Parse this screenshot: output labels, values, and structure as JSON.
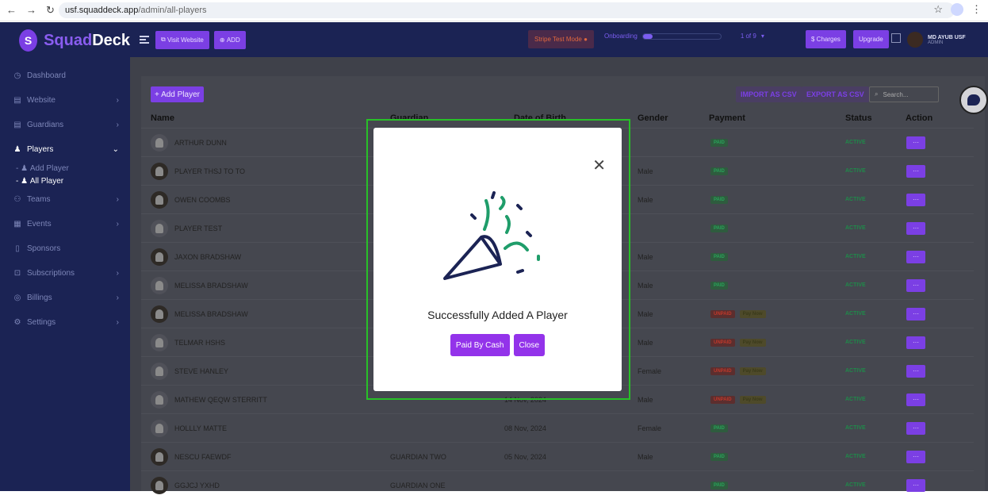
{
  "browser": {
    "host": "usf.squaddeck.app",
    "path": "/admin/all-players"
  },
  "logo": {
    "part1": "Squad",
    "part2": "Deck"
  },
  "sidebar": {
    "items": [
      {
        "label": "Dashboard",
        "icon": "dashboard-icon"
      },
      {
        "label": "Website",
        "icon": "website-icon"
      },
      {
        "label": "Guardians",
        "icon": "guardians-icon"
      },
      {
        "label": "Players",
        "icon": "players-icon"
      },
      {
        "label": "Teams",
        "icon": "teams-icon"
      },
      {
        "label": "Events",
        "icon": "events-icon"
      },
      {
        "label": "Sponsors",
        "icon": "sponsors-icon"
      },
      {
        "label": "Subscriptions",
        "icon": "subscriptions-icon"
      },
      {
        "label": "Billings",
        "icon": "billings-icon"
      },
      {
        "label": "Settings",
        "icon": "settings-icon"
      }
    ],
    "sub": {
      "add": "Add Player",
      "all": "All Player"
    }
  },
  "topbar": {
    "visit": "Visit Website",
    "add": "ADD",
    "stripe": "Stripe Test Mode",
    "onboarding": "Onboarding",
    "onboarding_progress": 0.12,
    "onboarding_count": "1 of 9",
    "charges": "Charges",
    "upgrade": "Upgrade",
    "user_name": "MD AYUB USF",
    "user_role": "ADMIN"
  },
  "toolbar": {
    "add_player": "+ Add Player",
    "import": "IMPORT AS CSV",
    "export": "EXPORT AS CSV",
    "search_placeholder": "Search..."
  },
  "table": {
    "headers": {
      "name": "Name",
      "guardian": "Guardian",
      "dob": "Date of Birth",
      "gender": "Gender",
      "payment": "Payment",
      "status": "Status",
      "action": "Action"
    },
    "rows": [
      {
        "name": "ARTHUR DUNN",
        "guardian": "",
        "dob": "",
        "gender": "",
        "payment": "PAID",
        "status": "ACTIVE"
      },
      {
        "name": "PLAYER THSJ TO TO",
        "guardian": "",
        "dob": "",
        "gender": "Male",
        "payment": "PAID",
        "status": "ACTIVE"
      },
      {
        "name": "OWEN COOMBS",
        "guardian": "",
        "dob": "",
        "gender": "Male",
        "payment": "PAID",
        "status": "ACTIVE"
      },
      {
        "name": "PLAYER TEST",
        "guardian": "",
        "dob": "",
        "gender": "",
        "payment": "PAID",
        "status": "ACTIVE"
      },
      {
        "name": "JAXON BRADSHAW",
        "guardian": "",
        "dob": "",
        "gender": "Male",
        "payment": "PAID",
        "status": "ACTIVE"
      },
      {
        "name": "MELISSA BRADSHAW",
        "guardian": "",
        "dob": "",
        "gender": "Male",
        "payment": "PAID",
        "status": "ACTIVE"
      },
      {
        "name": "MELISSA BRADSHAW",
        "guardian": "",
        "dob": "",
        "gender": "Male",
        "payment": "UNPAID",
        "status": "ACTIVE"
      },
      {
        "name": "TELMAR HSHS",
        "guardian": "",
        "dob": "",
        "gender": "Male",
        "payment": "UNPAID",
        "status": "ACTIVE"
      },
      {
        "name": "STEVE HANLEY",
        "guardian": "",
        "dob": "",
        "gender": "Female",
        "payment": "UNPAID",
        "status": "ACTIVE"
      },
      {
        "name": "MATHEW QEQW STERRITT",
        "guardian": "",
        "dob": "14 Nov, 2024",
        "gender": "Male",
        "payment": "UNPAID",
        "status": "ACTIVE"
      },
      {
        "name": "HOLLLY MATTE",
        "guardian": "",
        "dob": "08 Nov, 2024",
        "gender": "Female",
        "payment": "PAID",
        "status": "ACTIVE"
      },
      {
        "name": "NESCU FAEWDF",
        "guardian": "GUARDIAN TWO",
        "dob": "05 Nov, 2024",
        "gender": "Male",
        "payment": "PAID",
        "status": "ACTIVE"
      },
      {
        "name": "GGJCJ YXHD",
        "guardian": "GUARDIAN ONE",
        "dob": "",
        "gender": "",
        "payment": "PAID",
        "status": "ACTIVE"
      }
    ],
    "pay_now": "Pay Now",
    "action": "···"
  },
  "modal": {
    "title": "Successfully Added A Player",
    "paid_cash": "Paid By Cash",
    "close": "Close"
  }
}
